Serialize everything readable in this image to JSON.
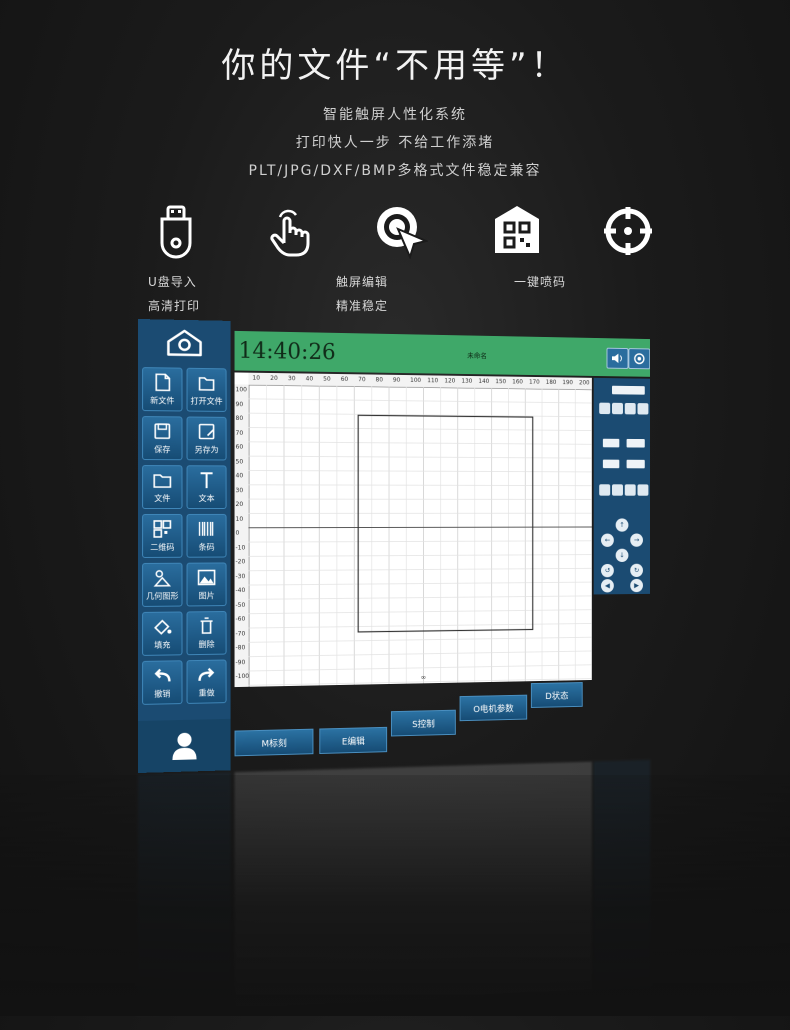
{
  "headline": "你的文件“不用等”！",
  "subtitles": [
    "智能触屏人性化系统",
    "打印快人一步  不给工作添堵",
    "PLT/JPG/DXF/BMP多格式文件稳定兼容"
  ],
  "features": {
    "usb_line1": "U盘导入",
    "usb_line2": "高清打印",
    "touch_line1": "触屏编辑",
    "touch_line2": "精准稳定",
    "qr_line1": "一键喷码"
  },
  "icons": [
    "usb-drive-icon",
    "touch-hand-icon",
    "cursor-target-icon",
    "qr-code-icon",
    "crosshair-icon"
  ],
  "screen": {
    "clock": "14:40:26",
    "topbar_center": "未命名",
    "tools": [
      {
        "label": "新文件"
      },
      {
        "label": "打开文件"
      },
      {
        "label": "保存"
      },
      {
        "label": "另存为"
      },
      {
        "label": "文件"
      },
      {
        "label": "文本"
      },
      {
        "label": "二维码"
      },
      {
        "label": "条码"
      },
      {
        "label": "几何图形"
      },
      {
        "label": "图片"
      },
      {
        "label": "填充"
      },
      {
        "label": "删除"
      },
      {
        "label": "撤销"
      },
      {
        "label": "重做"
      }
    ],
    "tabs": [
      "M标刻",
      "E编辑",
      "S控制",
      "O电机参数",
      "D状态"
    ],
    "ruler_top": [
      "10",
      "20",
      "30",
      "40",
      "50",
      "60",
      "70",
      "80",
      "90",
      "100",
      "110",
      "120",
      "130",
      "140",
      "150",
      "160",
      "170",
      "180",
      "190",
      "200"
    ],
    "ruler_left": [
      "100",
      "90",
      "80",
      "70",
      "60",
      "50",
      "40",
      "30",
      "20",
      "10",
      "0",
      "-10",
      "-20",
      "-30",
      "-40",
      "-50",
      "-60",
      "-70",
      "-80",
      "-90",
      "-100"
    ],
    "canvas_bottom": "∞"
  },
  "colors": {
    "sidebar": "#1b4b72",
    "topbar": "#3fa869",
    "button": "#2a6d9e",
    "background": "#1b1b1b"
  }
}
